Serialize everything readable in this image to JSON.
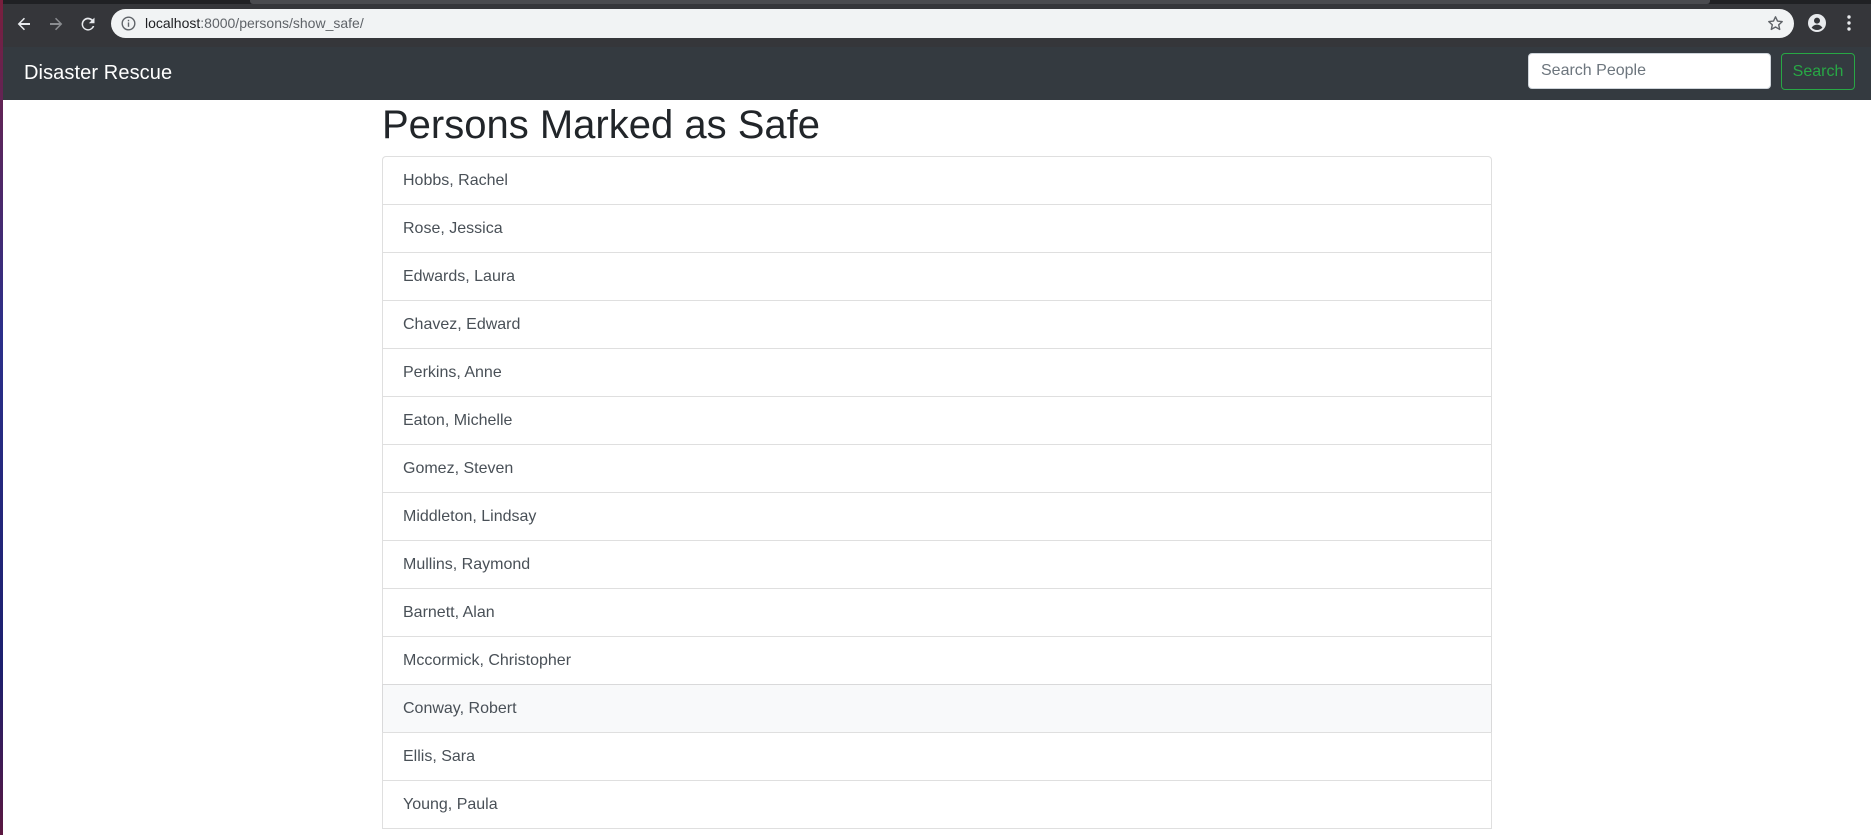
{
  "browser": {
    "url_host": "localhost",
    "url_rest": ":8000/persons/show_safe/"
  },
  "navbar": {
    "brand": "Disaster Rescue",
    "search_placeholder": "Search People",
    "search_button": "Search"
  },
  "main": {
    "title": "Persons Marked as Safe",
    "persons": [
      "Hobbs, Rachel",
      "Rose, Jessica",
      "Edwards, Laura",
      "Chavez, Edward",
      "Perkins, Anne",
      "Eaton, Michelle",
      "Gomez, Steven",
      "Middleton, Lindsay",
      "Mullins, Raymond",
      "Barnett, Alan",
      "Mccormick, Christopher",
      "Conway, Robert",
      "Ellis, Sara",
      "Young, Paula"
    ],
    "hovered_index": 11
  },
  "colors": {
    "navbar_bg": "#343a40",
    "success": "#28a745",
    "hover_bg": "#f8f9fa"
  },
  "icons": [
    "back-arrow-icon",
    "forward-arrow-icon",
    "reload-icon",
    "info-icon",
    "star-icon",
    "profile-icon",
    "kebab-menu-icon"
  ]
}
